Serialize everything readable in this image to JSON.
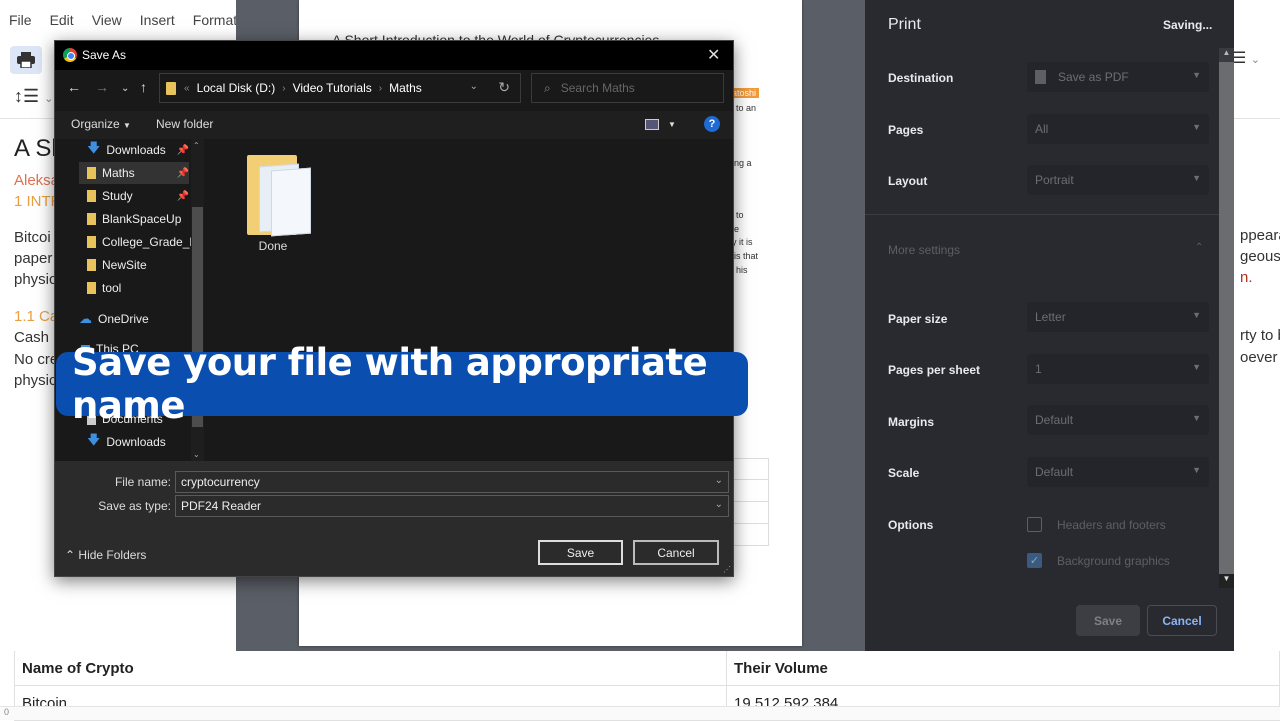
{
  "editor": {
    "menu": [
      "File",
      "Edit",
      "View",
      "Insert",
      "Format"
    ],
    "doc_title_fragment": "A Sh",
    "author_fragment": "Aleksa",
    "heading1_fragment": "1 INTR",
    "para1_fragments": [
      "Bitcoi",
      "paper",
      "physic"
    ],
    "heading2_fragment": "1.1 Ca",
    "para2_fragments": [
      "Cash i",
      "No cre",
      "physic"
    ],
    "right_fragments": [
      "ppeara",
      "geous c",
      "n.",
      "rty to b",
      "oever i"
    ],
    "table": {
      "headers": [
        "Name of Crypto",
        "Their Volume"
      ],
      "rows": [
        [
          "Bitcoin",
          "19,512,592,384"
        ]
      ]
    },
    "status": "0"
  },
  "preview": {
    "page_title": "A Short Introduction to the World of Cryptocurrencies",
    "tag_fragment": "atoshi",
    "fragments": [
      "to an",
      "ng a",
      "to",
      "e",
      "y it is",
      "is that",
      "his"
    ]
  },
  "print_panel": {
    "title": "Print",
    "status": "Saving...",
    "destination": {
      "label": "Destination",
      "value": "Save as PDF"
    },
    "pages": {
      "label": "Pages",
      "value": "All"
    },
    "layout": {
      "label": "Layout",
      "value": "Portrait"
    },
    "more_settings": "More settings",
    "paper_size": {
      "label": "Paper size",
      "value": "Letter"
    },
    "pages_per_sheet": {
      "label": "Pages per sheet",
      "value": "1"
    },
    "margins": {
      "label": "Margins",
      "value": "Default"
    },
    "scale": {
      "label": "Scale",
      "value": "Default"
    },
    "options": {
      "label": "Options",
      "headers_footers": {
        "label": "Headers and footers",
        "checked": false
      },
      "background_graphics": {
        "label": "Background graphics",
        "checked": true
      }
    },
    "save_button": "Save",
    "cancel_button": "Cancel"
  },
  "save_dialog": {
    "title": "Save As",
    "breadcrumb": [
      "Local Disk (D:)",
      "Video Tutorials",
      "Maths"
    ],
    "search_placeholder": "Search Maths",
    "organize": "Organize",
    "new_folder": "New folder",
    "tree": [
      {
        "label": "Downloads",
        "icon": "download",
        "pinned": true
      },
      {
        "label": "Maths",
        "icon": "folder",
        "pinned": true,
        "selected": true
      },
      {
        "label": "Study",
        "icon": "folder",
        "pinned": true
      },
      {
        "label": "BlankSpaceUp",
        "icon": "folder"
      },
      {
        "label": "College_Grade_F",
        "icon": "folder"
      },
      {
        "label": "NewSite",
        "icon": "folder"
      },
      {
        "label": "tool",
        "icon": "folder"
      },
      {
        "label": "OneDrive",
        "icon": "cloud"
      },
      {
        "label": "This PC",
        "icon": "pc"
      },
      {
        "label": "Documents",
        "icon": "documents"
      },
      {
        "label": "Downloads",
        "icon": "download"
      }
    ],
    "files": [
      {
        "label": "Done",
        "type": "folder"
      }
    ],
    "file_name_label": "File name:",
    "file_name_value": "cryptocurrency",
    "save_type_label": "Save as type:",
    "save_type_value": "PDF24 Reader",
    "hide_folders": "Hide Folders",
    "save_button": "Save",
    "cancel_button": "Cancel"
  },
  "caption": "Save your file with appropriate name"
}
